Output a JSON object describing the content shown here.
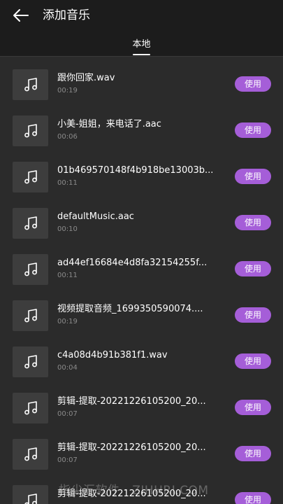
{
  "header": {
    "back_icon": "arrow-left-icon",
    "title": "添加音乐"
  },
  "tabs": [
    {
      "label": "本地",
      "active": true
    }
  ],
  "colors": {
    "background": "#2b2b2b",
    "header": "#1c1c1c",
    "accent": "#a55ed8",
    "thumb": "#3d3d3d",
    "duration_text": "#8a8a8a"
  },
  "items": [
    {
      "name": "跟你回家.wav",
      "duration": "00:19",
      "button": "使用",
      "icon": "music-note-icon"
    },
    {
      "name": "小美-姐姐，来电话了.aac",
      "duration": "00:06",
      "button": "使用",
      "icon": "music-note-icon"
    },
    {
      "name": "01b469570148f4b918be13003b...",
      "duration": "00:11",
      "button": "使用",
      "icon": "music-note-icon"
    },
    {
      "name": "defaultMusic.aac",
      "duration": "00:10",
      "button": "使用",
      "icon": "music-note-icon"
    },
    {
      "name": "ad44ef16684e4d8fa32154255f...",
      "duration": "00:11",
      "button": "使用",
      "icon": "music-note-icon"
    },
    {
      "name": "视频提取音频_1699350590074....",
      "duration": "00:19",
      "button": "使用",
      "icon": "music-note-icon"
    },
    {
      "name": "c4a08d4b91b381f1.wav",
      "duration": "00:04",
      "button": "使用",
      "icon": "music-note-icon"
    },
    {
      "name": "剪辑-提取-20221226105200_20...",
      "duration": "00:07",
      "button": "使用",
      "icon": "music-note-icon"
    },
    {
      "name": "剪辑-提取-20221226105200_20...",
      "duration": "00:07",
      "button": "使用",
      "icon": "music-note-icon"
    },
    {
      "name": "剪辑-提取-20221226105200_20...",
      "duration": "",
      "button": "使用",
      "icon": "music-note-icon"
    }
  ],
  "watermark": "指尖汇软件 · ZIHHRI.COM"
}
